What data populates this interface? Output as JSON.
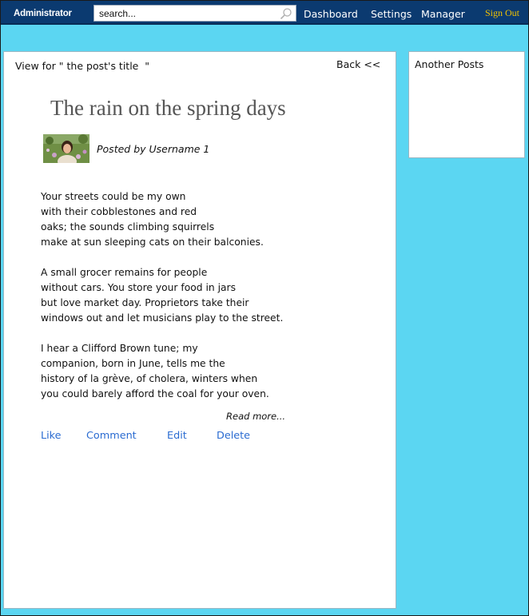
{
  "topbar": {
    "brand": "Administrator",
    "search_placeholder": "search...",
    "nav": [
      "Dashboard",
      "Settings",
      "Manager"
    ],
    "signout": "Sign Out"
  },
  "post": {
    "view_for": "View for \" the post's title  \"",
    "back": "Back <<",
    "title": "The rain on the spring days",
    "posted_by": "Posted by Username 1",
    "stanzas": [
      [
        "Your streets could be my own",
        "with their cobblestones and red",
        "oaks; the sounds climbing squirrels",
        "make at sun sleeping cats on their balconies."
      ],
      [
        "A small grocer remains for people",
        "without cars. You store your food in jars",
        "but love market day. Proprietors take their",
        "windows out and let musicians play to the street."
      ],
      [
        "I hear a Clifford Brown tune; my",
        "companion, born in June, tells me the",
        "history of la grève, of cholera, winters when",
        "you could barely afford the coal for your oven."
      ]
    ],
    "read_more": "Read more...",
    "actions": [
      "Like",
      "Comment",
      "Edit",
      "Delete"
    ]
  },
  "sidebar": {
    "title": "Another Posts"
  },
  "colors": {
    "background": "#5bd6f2",
    "topbar": "#0b3a70",
    "signout": "#f2c200",
    "link": "#2a6bd1"
  }
}
